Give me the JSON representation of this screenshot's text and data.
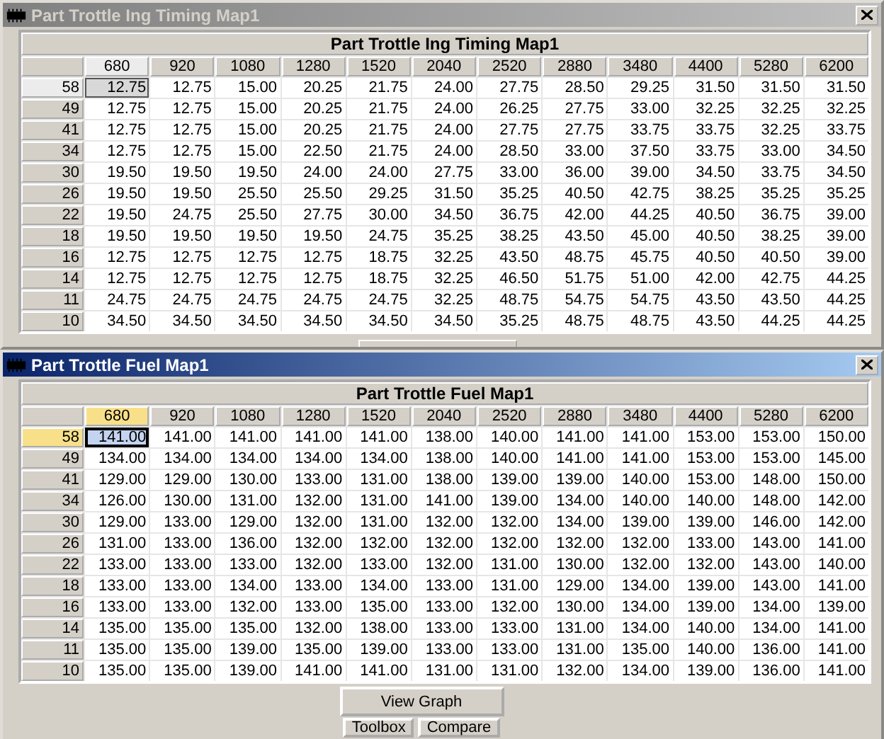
{
  "windows": [
    {
      "title": "Part Trottle Ing Timing Map1",
      "active": false,
      "table": {
        "title": "Part Trottle Ing Timing Map1",
        "columns": [
          {
            "label": "680",
            "selected": true
          },
          {
            "label": "920",
            "selected": false
          },
          {
            "label": "1080",
            "selected": false
          },
          {
            "label": "1280",
            "selected": false
          },
          {
            "label": "1520",
            "selected": false
          },
          {
            "label": "2040",
            "selected": false
          },
          {
            "label": "2520",
            "selected": false
          },
          {
            "label": "2880",
            "selected": false
          },
          {
            "label": "3480",
            "selected": false
          },
          {
            "label": "4400",
            "selected": false
          },
          {
            "label": "5280",
            "selected": false
          },
          {
            "label": "6200",
            "selected": false
          }
        ],
        "rows": [
          {
            "label": "58",
            "selected": true,
            "cells": [
              "12.75",
              "12.75",
              "15.00",
              "20.25",
              "21.75",
              "24.00",
              "27.75",
              "28.50",
              "29.25",
              "31.50",
              "31.50",
              "31.50"
            ]
          },
          {
            "label": "49",
            "selected": false,
            "cells": [
              "12.75",
              "12.75",
              "15.00",
              "20.25",
              "21.75",
              "24.00",
              "26.25",
              "27.75",
              "33.00",
              "32.25",
              "32.25",
              "32.25"
            ]
          },
          {
            "label": "41",
            "selected": false,
            "cells": [
              "12.75",
              "12.75",
              "15.00",
              "20.25",
              "21.75",
              "24.00",
              "27.75",
              "27.75",
              "33.75",
              "33.75",
              "32.25",
              "33.75"
            ]
          },
          {
            "label": "34",
            "selected": false,
            "cells": [
              "12.75",
              "12.75",
              "15.00",
              "22.50",
              "21.75",
              "24.00",
              "28.50",
              "33.00",
              "37.50",
              "33.75",
              "33.00",
              "34.50"
            ]
          },
          {
            "label": "30",
            "selected": false,
            "cells": [
              "19.50",
              "19.50",
              "19.50",
              "24.00",
              "24.00",
              "27.75",
              "33.00",
              "36.00",
              "39.00",
              "34.50",
              "33.75",
              "34.50"
            ]
          },
          {
            "label": "26",
            "selected": false,
            "cells": [
              "19.50",
              "19.50",
              "25.50",
              "25.50",
              "29.25",
              "31.50",
              "35.25",
              "40.50",
              "42.75",
              "38.25",
              "35.25",
              "35.25"
            ]
          },
          {
            "label": "22",
            "selected": false,
            "cells": [
              "19.50",
              "24.75",
              "25.50",
              "27.75",
              "30.00",
              "34.50",
              "36.75",
              "42.00",
              "44.25",
              "40.50",
              "36.75",
              "39.00"
            ]
          },
          {
            "label": "18",
            "selected": false,
            "cells": [
              "19.50",
              "19.50",
              "19.50",
              "19.50",
              "24.75",
              "35.25",
              "38.25",
              "43.50",
              "45.00",
              "40.50",
              "38.25",
              "39.00"
            ]
          },
          {
            "label": "16",
            "selected": false,
            "cells": [
              "12.75",
              "12.75",
              "12.75",
              "12.75",
              "18.75",
              "32.25",
              "43.50",
              "48.75",
              "45.75",
              "40.50",
              "40.50",
              "39.00"
            ]
          },
          {
            "label": "14",
            "selected": false,
            "cells": [
              "12.75",
              "12.75",
              "12.75",
              "12.75",
              "18.75",
              "32.25",
              "46.50",
              "51.75",
              "51.00",
              "42.00",
              "42.75",
              "44.25"
            ]
          },
          {
            "label": "11",
            "selected": false,
            "cells": [
              "24.75",
              "24.75",
              "24.75",
              "24.75",
              "24.75",
              "32.25",
              "48.75",
              "54.75",
              "54.75",
              "43.50",
              "43.50",
              "44.25"
            ]
          },
          {
            "label": "10",
            "selected": false,
            "cells": [
              "34.50",
              "34.50",
              "34.50",
              "34.50",
              "34.50",
              "34.50",
              "35.25",
              "48.75",
              "48.75",
              "43.50",
              "44.25",
              "44.25"
            ]
          }
        ]
      }
    },
    {
      "title": "Part Trottle Fuel Map1",
      "active": true,
      "table": {
        "title": "Part Trottle Fuel Map1",
        "columns": [
          {
            "label": "680",
            "selected": true
          },
          {
            "label": "920",
            "selected": false
          },
          {
            "label": "1080",
            "selected": false
          },
          {
            "label": "1280",
            "selected": false
          },
          {
            "label": "1520",
            "selected": false
          },
          {
            "label": "2040",
            "selected": false
          },
          {
            "label": "2520",
            "selected": false
          },
          {
            "label": "2880",
            "selected": false
          },
          {
            "label": "3480",
            "selected": false
          },
          {
            "label": "4400",
            "selected": false
          },
          {
            "label": "5280",
            "selected": false
          },
          {
            "label": "6200",
            "selected": false
          }
        ],
        "rows": [
          {
            "label": "58",
            "selected": true,
            "cells": [
              "141.00",
              "141.00",
              "141.00",
              "141.00",
              "141.00",
              "138.00",
              "140.00",
              "141.00",
              "141.00",
              "153.00",
              "153.00",
              "150.00"
            ]
          },
          {
            "label": "49",
            "selected": false,
            "cells": [
              "134.00",
              "134.00",
              "134.00",
              "134.00",
              "134.00",
              "138.00",
              "140.00",
              "141.00",
              "141.00",
              "153.00",
              "153.00",
              "145.00"
            ]
          },
          {
            "label": "41",
            "selected": false,
            "cells": [
              "129.00",
              "129.00",
              "130.00",
              "133.00",
              "131.00",
              "138.00",
              "139.00",
              "139.00",
              "140.00",
              "153.00",
              "148.00",
              "150.00"
            ]
          },
          {
            "label": "34",
            "selected": false,
            "cells": [
              "126.00",
              "130.00",
              "131.00",
              "132.00",
              "131.00",
              "141.00",
              "139.00",
              "134.00",
              "140.00",
              "140.00",
              "148.00",
              "142.00"
            ]
          },
          {
            "label": "30",
            "selected": false,
            "cells": [
              "129.00",
              "133.00",
              "129.00",
              "132.00",
              "131.00",
              "132.00",
              "132.00",
              "134.00",
              "139.00",
              "139.00",
              "146.00",
              "142.00"
            ]
          },
          {
            "label": "26",
            "selected": false,
            "cells": [
              "131.00",
              "133.00",
              "136.00",
              "132.00",
              "132.00",
              "132.00",
              "132.00",
              "132.00",
              "132.00",
              "133.00",
              "143.00",
              "141.00"
            ]
          },
          {
            "label": "22",
            "selected": false,
            "cells": [
              "133.00",
              "133.00",
              "133.00",
              "132.00",
              "133.00",
              "132.00",
              "131.00",
              "130.00",
              "132.00",
              "132.00",
              "143.00",
              "140.00"
            ]
          },
          {
            "label": "18",
            "selected": false,
            "cells": [
              "133.00",
              "133.00",
              "134.00",
              "133.00",
              "134.00",
              "133.00",
              "131.00",
              "129.00",
              "134.00",
              "139.00",
              "143.00",
              "141.00"
            ]
          },
          {
            "label": "16",
            "selected": false,
            "cells": [
              "133.00",
              "133.00",
              "132.00",
              "133.00",
              "135.00",
              "133.00",
              "132.00",
              "130.00",
              "134.00",
              "139.00",
              "134.00",
              "139.00"
            ]
          },
          {
            "label": "14",
            "selected": false,
            "cells": [
              "135.00",
              "135.00",
              "135.00",
              "132.00",
              "138.00",
              "133.00",
              "133.00",
              "131.00",
              "134.00",
              "140.00",
              "134.00",
              "141.00"
            ]
          },
          {
            "label": "11",
            "selected": false,
            "cells": [
              "135.00",
              "135.00",
              "139.00",
              "135.00",
              "139.00",
              "133.00",
              "133.00",
              "131.00",
              "135.00",
              "140.00",
              "136.00",
              "141.00"
            ]
          },
          {
            "label": "10",
            "selected": false,
            "cells": [
              "135.00",
              "135.00",
              "139.00",
              "141.00",
              "141.00",
              "131.00",
              "131.00",
              "132.00",
              "134.00",
              "139.00",
              "136.00",
              "141.00"
            ]
          }
        ]
      },
      "buttons": [
        {
          "label": "View Graph",
          "kind": "wide"
        },
        {
          "label": "Toolbox",
          "kind": "small"
        },
        {
          "label": "Compare",
          "kind": "small"
        }
      ]
    }
  ]
}
